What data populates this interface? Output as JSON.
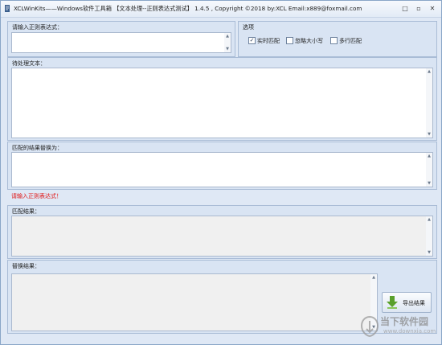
{
  "window": {
    "title": "XCLWinKits——Windows软件工具箱 【文本处理--正则表达式测试】 1.4.5 , Copyright ©2018 by:XCL Email:x889@foxmail.com",
    "controls": {
      "minimize": "□",
      "restore": "▫",
      "close": "✕"
    }
  },
  "regex_input": {
    "label": "请输入正则表达式：",
    "value": ""
  },
  "options": {
    "label": "选项",
    "items": [
      {
        "label": "实时匹配",
        "checked": true,
        "mark": "✓"
      },
      {
        "label": "忽略大小写",
        "checked": false,
        "mark": ""
      },
      {
        "label": "多行匹配",
        "checked": false,
        "mark": ""
      }
    ]
  },
  "source_text": {
    "label": "待处理文本：",
    "value": ""
  },
  "replace_input": {
    "label": "匹配的结果替换为：",
    "value": ""
  },
  "error_message": "请输入正则表达式！",
  "match_result": {
    "label": "匹配结果：",
    "value": ""
  },
  "replace_result": {
    "label": "替换结果：",
    "value": ""
  },
  "export_button": {
    "label": "导出结果"
  },
  "watermark": {
    "line1": "当下软件园",
    "line2": "www.downxia.com"
  },
  "scroll_arrows": {
    "up": "▲",
    "down": "▼"
  },
  "colors": {
    "error": "#e01414",
    "window_bg": "#dfe8f5",
    "group_bg": "#d9e4f3"
  }
}
